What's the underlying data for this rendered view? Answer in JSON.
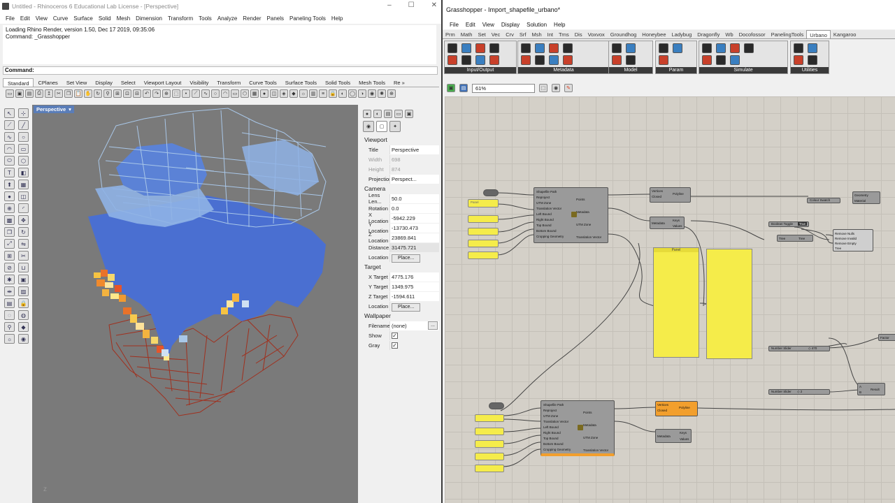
{
  "rhino": {
    "title": "Untitled - Rhinoceros 6 Educational Lab License - [Perspective]",
    "menu": [
      "File",
      "Edit",
      "View",
      "Curve",
      "Surface",
      "Solid",
      "Mesh",
      "Dimension",
      "Transform",
      "Tools",
      "Analyze",
      "Render",
      "Panels",
      "Paneling Tools",
      "Help"
    ],
    "history": [
      "Loading Rhino Render, version 1.50, Dec 17 2019, 09:35:06",
      "Command: _Grasshopper"
    ],
    "command_label": "Command:",
    "toolbar_tabs": [
      "Standard",
      "CPlanes",
      "Set View",
      "Display",
      "Select",
      "Viewport Layout",
      "Visibility",
      "Transform",
      "Curve Tools",
      "Surface Tools",
      "Solid Tools",
      "Mesh Tools",
      "Re »"
    ],
    "viewport_name": "Perspective",
    "viewport_caret": "▾",
    "axis_label": "z",
    "properties": {
      "viewport_header": "Viewport",
      "title_k": "Title",
      "title_v": "Perspective",
      "width_k": "Width",
      "width_v": "698",
      "height_k": "Height",
      "height_v": "874",
      "projection_k": "Projection",
      "projection_v": "Perspect...",
      "camera_header": "Camera",
      "lens_k": "Lens Len...",
      "lens_v": "50.0",
      "rotation_k": "Rotation",
      "rotation_v": "0.0",
      "xloc_k": "X Location",
      "xloc_v": "-5942.229",
      "yloc_k": "Y Location",
      "yloc_v": "-13730.473",
      "zloc_k": "Z Location",
      "zloc_v": "23869.841",
      "dist_k": "Distance...",
      "dist_v": "31475.721",
      "location_k": "Location",
      "place_label": "Place...",
      "target_header": "Target",
      "xt_k": "X Target",
      "xt_v": "4775.176",
      "yt_k": "Y Target",
      "yt_v": "1349.975",
      "zt_k": "Z Target",
      "zt_v": "-1594.611",
      "tloc_k": "Location",
      "wallpaper_header": "Wallpaper",
      "filename_k": "Filename",
      "filename_v": "(none)",
      "ellipsis": "...",
      "show_k": "Show",
      "gray_k": "Gray",
      "check": "✓"
    }
  },
  "gh": {
    "title": "Grasshopper - Import_shapefile_urbano*",
    "menu": [
      "File",
      "Edit",
      "View",
      "Display",
      "Solution",
      "Help"
    ],
    "tabs": [
      "Prm",
      "Math",
      "Set",
      "Vec",
      "Crv",
      "Srf",
      "Msh",
      "Int",
      "Trns",
      "Dis",
      "Voxvox",
      "Groundhog",
      "Honeybee",
      "Ladybug",
      "Dragonfly",
      "Wb",
      "Docofossor",
      "PanelingTools",
      "Urbano",
      "Kangaroo"
    ],
    "active_tab": "Urbano",
    "groups": [
      "Input/Output",
      "Metadata",
      "Model",
      "Param",
      "Simulate",
      "Utilities"
    ],
    "zoom": "61%",
    "components": {
      "import1_inputs": [
        "Shapefile Path",
        "Reproject",
        "UTM Zone",
        "Translation Vector",
        "Left Bound",
        "Right Bound",
        "Top Bound",
        "Bottom Bound",
        "Cropping Geometry"
      ],
      "import1_outputs": [
        "Points",
        "Metadata",
        "UTM Zone",
        "Translation Vector"
      ],
      "polyline_in": [
        "Vertices",
        "Closed"
      ],
      "polyline_name": "Polyline",
      "keys_in": "Metadata",
      "keys_out": [
        "Keys",
        "Values"
      ],
      "panel_label": "Panel",
      "geometry": "Geometry",
      "material": "Material",
      "colour_swatch": "Colour Swatch",
      "boolean_toggle": "Boolean Toggle",
      "toggle_val": "True",
      "tree": "Tree",
      "remove_in": [
        "Remove Nulls",
        "Remove Invalid",
        "Remove Empty",
        "Tree"
      ],
      "number_slider": "Number Slider",
      "slider1_val": "◇ 470",
      "slider2_val": "◇ 2",
      "factor": "Factor",
      "result": "Result",
      "ab": [
        "A",
        "B"
      ]
    }
  }
}
